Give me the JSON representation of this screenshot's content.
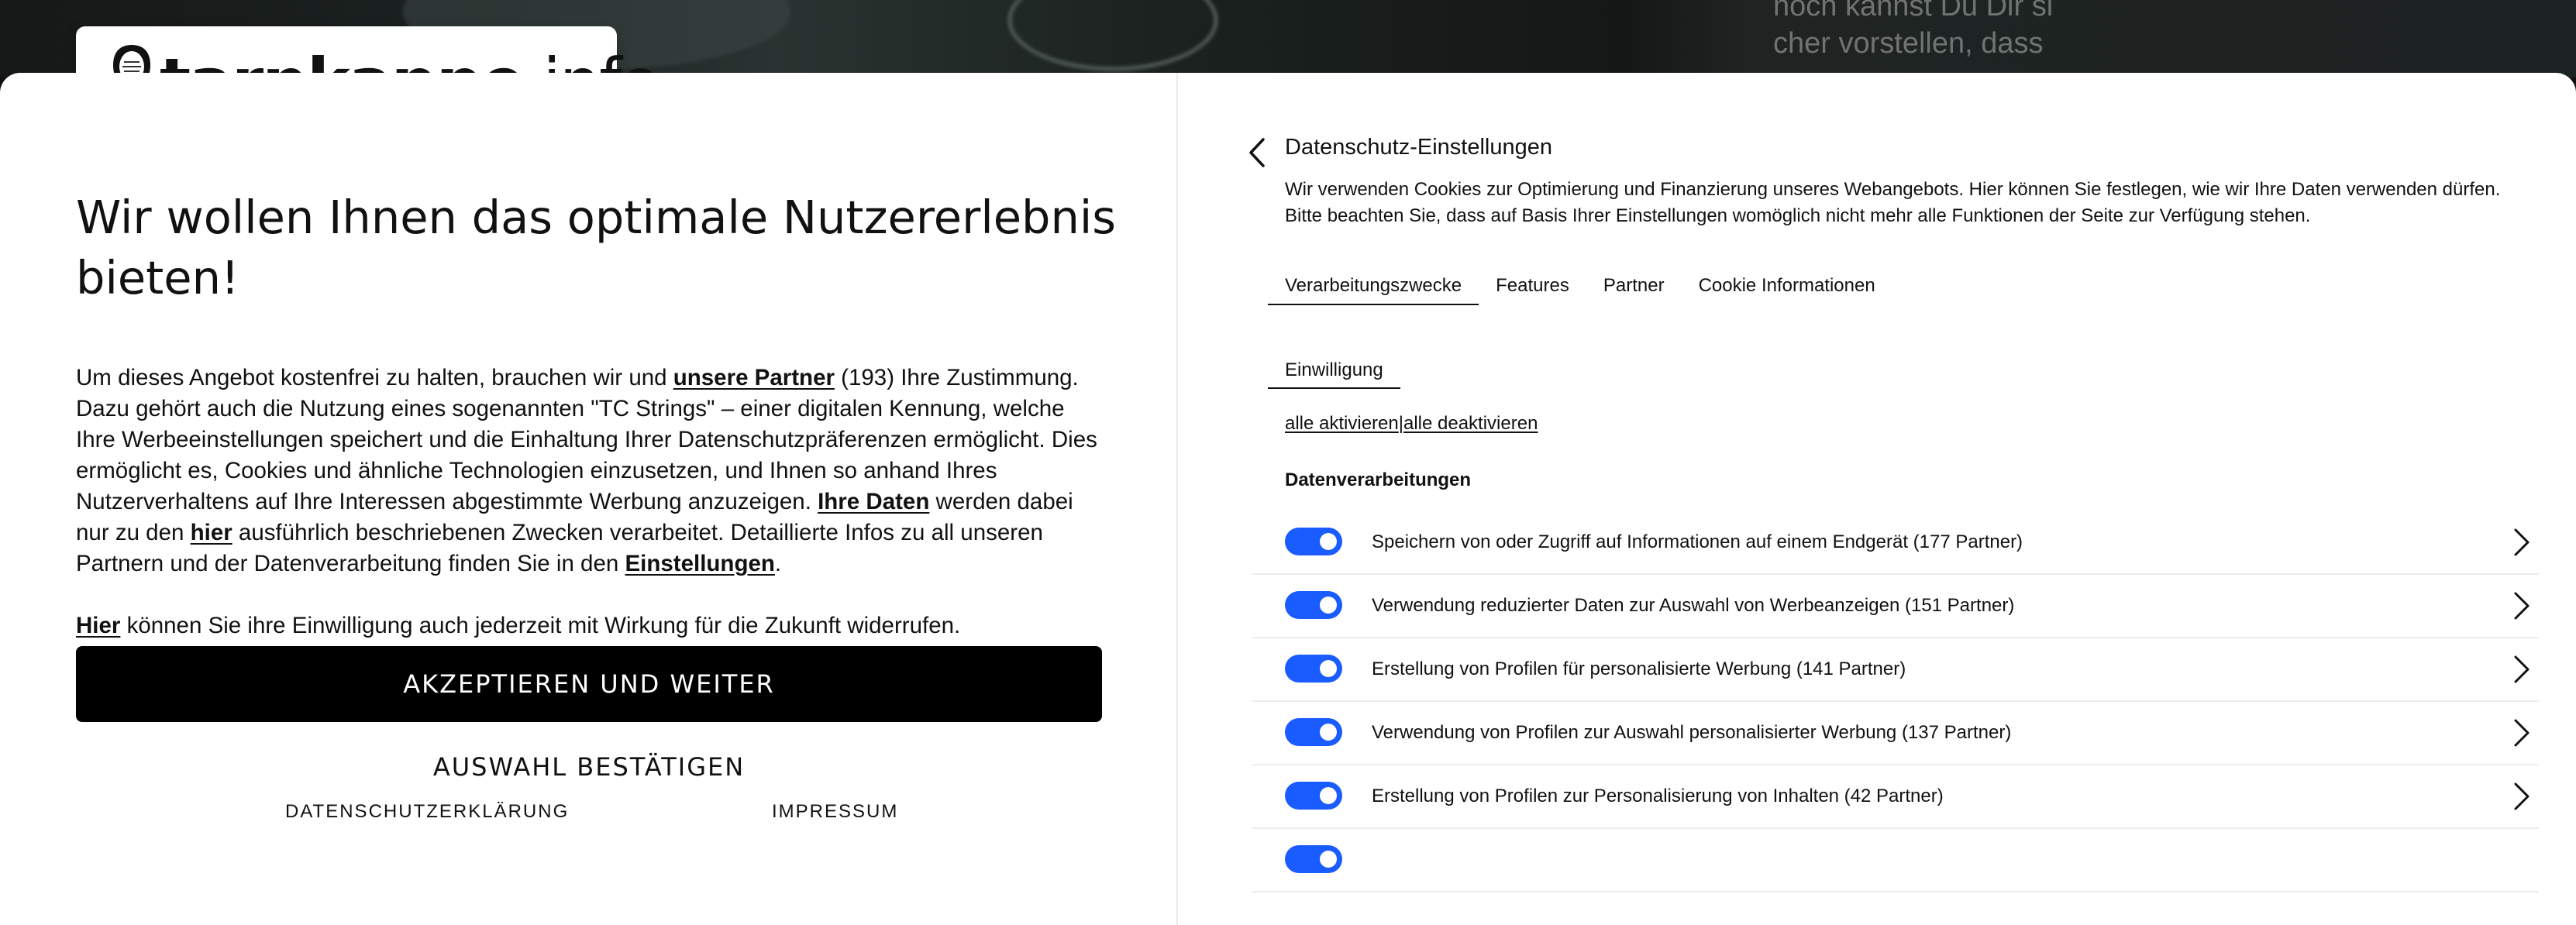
{
  "background": {
    "article_text": "noch kannst Du Dir si\ncher vorstellen, dass"
  },
  "logo": {
    "brand_bold": "tarnkappe",
    "brand_light": ".info"
  },
  "left": {
    "headline": "Wir wollen Ihnen das optimale Nutzererlebnis bieten!",
    "intro_1": "Um dieses Angebot kostenfrei zu halten, brauchen wir und ",
    "link_partners": "unsere Partner",
    "intro_2": " (193) Ihre Zustimmung. Dazu gehört auch die Nutzung eines sogenannten \"TC Strings\" – einer digitalen Kennung, welche Ihre Werbeeinstellungen speichert und die Einhaltung Ihrer Datenschutzpräferenzen ermöglicht. Dies ermöglicht es, Cookies und ähnliche Technologien einzusetzen, und Ihnen so anhand Ihres Nutzerverhaltens auf Ihre Interessen abgestimmte Werbung anzuzeigen. ",
    "link_your_data": "Ihre Daten",
    "intro_3": " werden dabei nur zu den ",
    "link_here": "hier",
    "intro_4": " ausführlich beschriebenen Zwecken verarbeitet. Detaillierte Infos zu all unseren Partnern und der Datenverarbeitung finden Sie in den ",
    "link_settings": "Einstellungen",
    "intro_5": ".",
    "revoke_link": "Hier",
    "revoke_text": " können Sie ihre Einwilligung auch jederzeit mit Wirkung für die Zukunft widerrufen.",
    "accept_label": "AKZEPTIEREN UND WEITER",
    "confirm_label": "AUSWAHL BESTÄTIGEN",
    "privacy_label": "DATENSCHUTZERKLÄRUNG",
    "imprint_label": "IMPRESSUM"
  },
  "right": {
    "title": "Datenschutz-Einstellungen",
    "description": "Wir verwenden Cookies zur Optimierung und Finanzierung unseres Webangebots. Hier können Sie festlegen, wie wir Ihre Daten verwenden dürfen. Bitte beachten Sie, dass auf Basis Ihrer Einstellungen womöglich nicht mehr alle Funktionen der Seite zur Verfügung stehen.",
    "tabs": [
      "Verarbeitungszwecke",
      "Features",
      "Partner",
      "Cookie Informationen"
    ],
    "active_tab": "Verarbeitungszwecke",
    "consent_tab": "Einwilligung",
    "activate_all": "alle aktivieren",
    "separator": "|",
    "deactivate_all": "alle deaktivieren",
    "section_title": "Datenverarbeitungen",
    "purposes": [
      {
        "label": "Speichern von oder Zugriff auf Informationen auf einem Endgerät (177 Partner)",
        "enabled": true
      },
      {
        "label": "Verwendung reduzierter Daten zur Auswahl von Werbeanzeigen (151 Partner)",
        "enabled": true
      },
      {
        "label": "Erstellung von Profilen für personalisierte Werbung (141 Partner)",
        "enabled": true
      },
      {
        "label": "Verwendung von Profilen zur Auswahl personalisierter Werbung (137 Partner)",
        "enabled": true
      },
      {
        "label": "Erstellung von Profilen zur Personalisierung von Inhalten (42 Partner)",
        "enabled": true
      },
      {
        "label": "",
        "enabled": true
      }
    ]
  },
  "colors": {
    "toggle_on": "#1a5cff",
    "accept_bg": "#000000"
  }
}
